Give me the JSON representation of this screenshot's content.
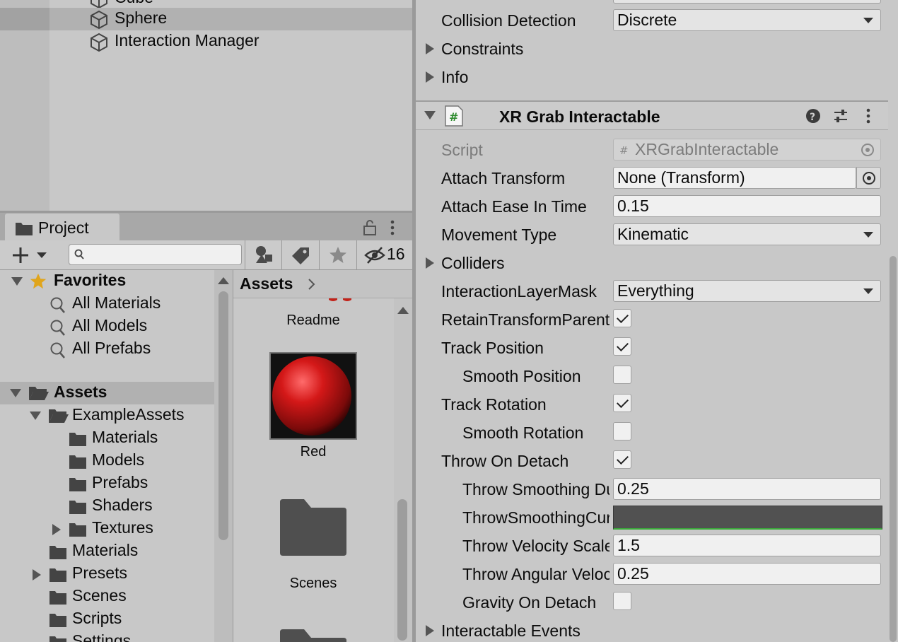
{
  "hierarchy": {
    "items": [
      {
        "label": "Cube"
      },
      {
        "label": "Sphere",
        "selected": true
      },
      {
        "label": "Interaction Manager"
      }
    ]
  },
  "project": {
    "tab_label": "Project",
    "search": {
      "value": "",
      "placeholder": ""
    },
    "hidden_count": "16",
    "tree": {
      "favorites": {
        "label": "Favorites",
        "items": [
          "All Materials",
          "All Models",
          "All Prefabs"
        ]
      },
      "assets": {
        "label": "Assets",
        "example_assets": {
          "label": "ExampleAssets",
          "items": [
            "Materials",
            "Models",
            "Prefabs",
            "Shaders",
            "Textures"
          ]
        },
        "items": [
          "Materials",
          "Presets",
          "Scenes",
          "Scripts",
          "Settings"
        ]
      }
    },
    "breadcrumb": {
      "root": "Assets"
    },
    "grid": {
      "items": [
        "Readme",
        "Red",
        "Scenes"
      ]
    }
  },
  "inspector": {
    "rigidbody_tail": {
      "collision_detection": {
        "label": "Collision Detection",
        "value": "Discrete"
      },
      "constraints": "Constraints",
      "info": "Info"
    },
    "component": {
      "title": "XR Grab Interactable",
      "script": {
        "label": "Script",
        "value": "XRGrabInteractable"
      },
      "attach_transform": {
        "label": "Attach Transform",
        "value": "None (Transform)"
      },
      "attach_ease_in_time": {
        "label": "Attach Ease In Time",
        "value": "0.15"
      },
      "movement_type": {
        "label": "Movement Type",
        "value": "Kinematic"
      },
      "colliders": "Colliders",
      "interaction_layer_mask": {
        "label": "InteractionLayerMask",
        "value": "Everything"
      },
      "retain_transform_parent": {
        "label": "RetainTransformParent",
        "checked": true
      },
      "track_position": {
        "label": "Track Position",
        "checked": true
      },
      "smooth_position": {
        "label": "Smooth Position",
        "checked": false
      },
      "track_rotation": {
        "label": "Track Rotation",
        "checked": true
      },
      "smooth_rotation": {
        "label": "Smooth Rotation",
        "checked": false
      },
      "throw_on_detach": {
        "label": "Throw On Detach",
        "checked": true
      },
      "throw_smoothing_duration": {
        "label": "Throw Smoothing Duration",
        "value": "0.25"
      },
      "throw_smoothing_curve": {
        "label": "ThrowSmoothingCurve"
      },
      "throw_velocity_scale": {
        "label": "Throw Velocity Scale",
        "value": "1.5"
      },
      "throw_angular_velocity_scale": {
        "label": "Throw Angular Velocity Scale",
        "value": "0.25"
      },
      "gravity_on_detach": {
        "label": "Gravity On Detach",
        "checked": false
      },
      "interactable_events": "Interactable Events"
    }
  }
}
